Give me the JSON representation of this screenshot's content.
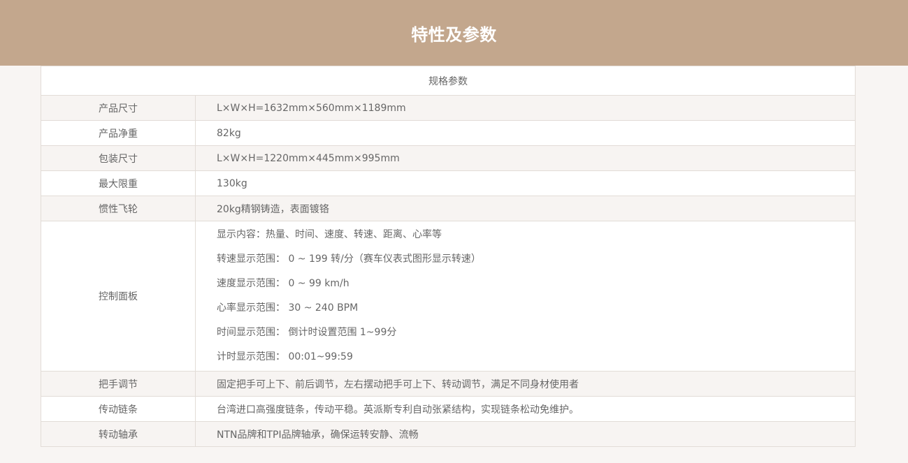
{
  "header": {
    "title": "特性及参数"
  },
  "table": {
    "caption": "规格参数",
    "rows": [
      {
        "label": "产品尺寸",
        "lines": [
          "L×W×H=1632mm×560mm×1189mm"
        ]
      },
      {
        "label": "产品净重",
        "lines": [
          "82kg"
        ]
      },
      {
        "label": "包装尺寸",
        "lines": [
          "L×W×H=1220mm×445mm×995mm"
        ]
      },
      {
        "label": "最大限重",
        "lines": [
          "130kg"
        ]
      },
      {
        "label": "惯性飞轮",
        "lines": [
          "20kg精钢铸造，表面镀铬"
        ]
      },
      {
        "label": "控制面板",
        "lines": [
          "显示内容：热量、时间、速度、转速、距离、心率等",
          "转速显示范围： 0 ~ 199 转/分（赛车仪表式图形显示转速）",
          "速度显示范围： 0 ~ 99 km/h",
          "心率显示范围： 30 ~ 240 BPM",
          "时间显示范围： 倒计时设置范围 1~99分",
          "计时显示范围： 00:01~99:59"
        ]
      },
      {
        "label": "把手调节",
        "lines": [
          "固定把手可上下、前后调节，左右摆动把手可上下、转动调节，满足不同身材使用者"
        ]
      },
      {
        "label": "传动链条",
        "lines": [
          "台湾进口高强度链条，传动平稳。英派斯专利自动张紧结构，实现链条松动免维护。"
        ]
      },
      {
        "label": "转动轴承",
        "lines": [
          "NTN品牌和TPI品牌轴承，确保运转安静、流畅"
        ]
      }
    ]
  }
}
